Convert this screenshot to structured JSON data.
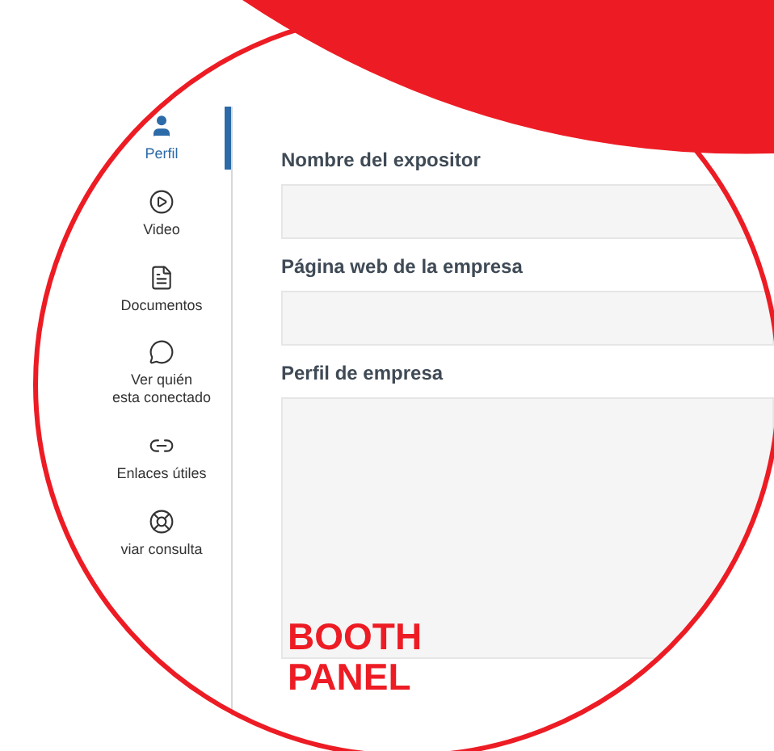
{
  "sidebar": {
    "items": [
      {
        "kind": "user",
        "label": "Perfil",
        "selected": true
      },
      {
        "kind": "video",
        "label": "Video",
        "selected": false
      },
      {
        "kind": "documents",
        "label": "Documentos",
        "selected": false
      },
      {
        "kind": "chat",
        "label": "Ver quién\nesta conectado",
        "selected": false
      },
      {
        "kind": "link",
        "label": "Enlaces útiles",
        "selected": false
      },
      {
        "kind": "help",
        "label": "viar consulta",
        "selected": false
      }
    ]
  },
  "form": {
    "fields": [
      {
        "kind": "input",
        "label": "Nombre del expositor"
      },
      {
        "kind": "input",
        "label": "Página web de la empresa"
      },
      {
        "kind": "textarea",
        "label": "Perfil de empresa"
      }
    ]
  },
  "banner": {
    "title": "BOOTH\nPANEL"
  }
}
